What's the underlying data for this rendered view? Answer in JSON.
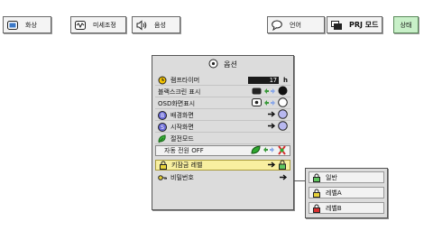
{
  "tabs": [
    {
      "label": "화상",
      "icon": "picture-icon"
    },
    {
      "label": "미세조정",
      "icon": "fine-sync-icon"
    },
    {
      "label": "음성",
      "icon": "speaker-icon"
    },
    {
      "label": "언어",
      "icon": "speech-bubble-icon"
    },
    {
      "label": "PRJ 모드",
      "icon": "projector-mode-icon"
    },
    {
      "label": "상태",
      "icon": ""
    }
  ],
  "menu": {
    "title": "옵션",
    "items": [
      {
        "label": "램프타이머",
        "value": "17",
        "unit": "h"
      },
      {
        "label": "블랙스크린 표시"
      },
      {
        "label": "OSD화면표시"
      },
      {
        "label": "배경화면"
      },
      {
        "label": "시작화면"
      },
      {
        "label": "절전모드"
      },
      {
        "label": "자동 전원 OFF"
      },
      {
        "label": "키잠금 레벨"
      },
      {
        "label": "비밀번호"
      }
    ]
  },
  "submenu": {
    "items": [
      {
        "label": "일반"
      },
      {
        "label": "레벨A"
      },
      {
        "label": "레벨B"
      }
    ]
  },
  "colors": {
    "active_tab": "#c8f0c8",
    "highlight": "#f8efa0",
    "lock_green": "#5fc65f",
    "lock_yellow": "#e8d23a",
    "lock_red": "#d83030"
  }
}
